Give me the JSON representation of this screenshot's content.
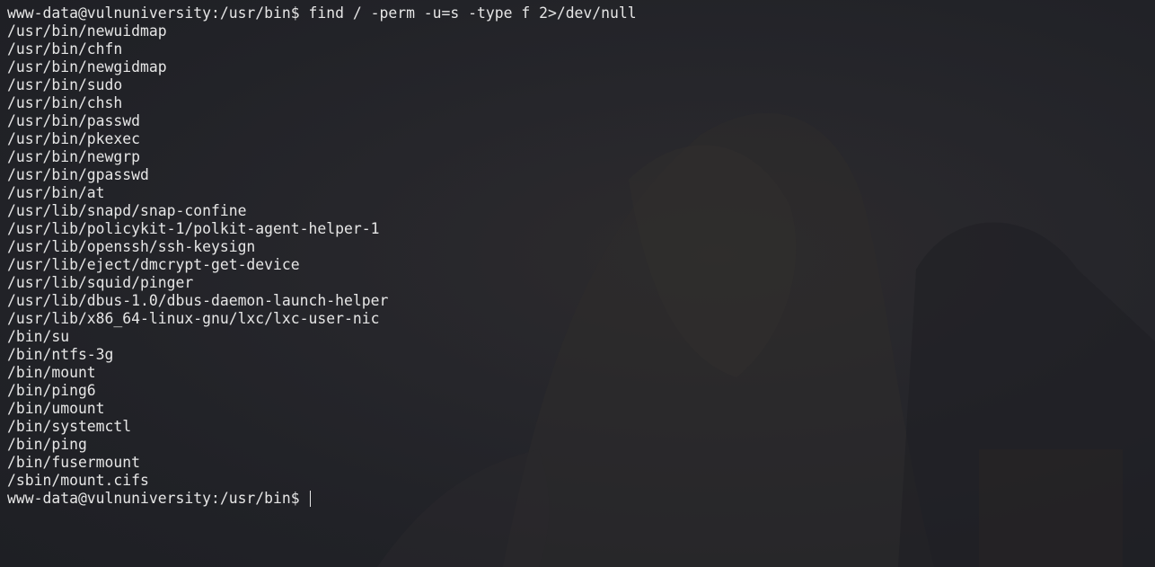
{
  "terminal": {
    "command_line": {
      "prompt": "www-data@vulnuniversity:/usr/bin$ ",
      "command": "find / -perm -u=s -type f 2>/dev/null"
    },
    "output_lines": [
      "/usr/bin/newuidmap",
      "/usr/bin/chfn",
      "/usr/bin/newgidmap",
      "/usr/bin/sudo",
      "/usr/bin/chsh",
      "/usr/bin/passwd",
      "/usr/bin/pkexec",
      "/usr/bin/newgrp",
      "/usr/bin/gpasswd",
      "/usr/bin/at",
      "/usr/lib/snapd/snap-confine",
      "/usr/lib/policykit-1/polkit-agent-helper-1",
      "/usr/lib/openssh/ssh-keysign",
      "/usr/lib/eject/dmcrypt-get-device",
      "/usr/lib/squid/pinger",
      "/usr/lib/dbus-1.0/dbus-daemon-launch-helper",
      "/usr/lib/x86_64-linux-gnu/lxc/lxc-user-nic",
      "/bin/su",
      "/bin/ntfs-3g",
      "/bin/mount",
      "/bin/ping6",
      "/bin/umount",
      "/bin/systemctl",
      "/bin/ping",
      "/bin/fusermount",
      "/sbin/mount.cifs"
    ],
    "current_prompt": "www-data@vulnuniversity:/usr/bin$ "
  },
  "colors": {
    "background": "#24252a",
    "text": "#e6e6e6"
  }
}
